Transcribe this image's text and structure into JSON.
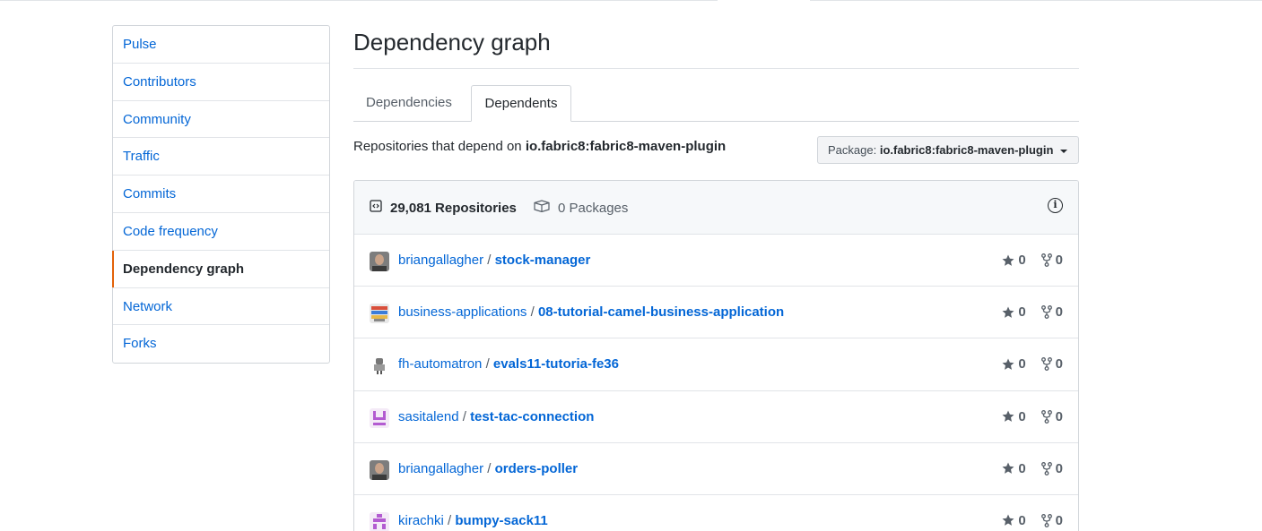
{
  "sidebar": {
    "items": [
      {
        "label": "Pulse"
      },
      {
        "label": "Contributors"
      },
      {
        "label": "Community"
      },
      {
        "label": "Traffic"
      },
      {
        "label": "Commits"
      },
      {
        "label": "Code frequency"
      },
      {
        "label": "Dependency graph",
        "selected": true
      },
      {
        "label": "Network"
      },
      {
        "label": "Forks"
      }
    ]
  },
  "main": {
    "title": "Dependency graph",
    "tabs": [
      {
        "label": "Dependencies"
      },
      {
        "label": "Dependents",
        "selected": true
      }
    ],
    "depends_prefix": "Repositories that depend on",
    "depends_package": "io.fabric8:fabric8-maven-plugin",
    "package_select": {
      "label": "Package:",
      "value": "io.fabric8:fabric8-maven-plugin"
    },
    "summary": {
      "repositories": "29,081 Repositories",
      "packages": "0 Packages"
    },
    "rows": [
      {
        "owner": "briangallagher",
        "repo": "stock-manager",
        "stars": "0",
        "forks": "0"
      },
      {
        "owner": "business-applications",
        "repo": "08-tutorial-camel-business-application",
        "stars": "0",
        "forks": "0"
      },
      {
        "owner": "fh-automatron",
        "repo": "evals11-tutoria-fe36",
        "stars": "0",
        "forks": "0"
      },
      {
        "owner": "sasitalend",
        "repo": "test-tac-connection",
        "stars": "0",
        "forks": "0"
      },
      {
        "owner": "briangallagher",
        "repo": "orders-poller",
        "stars": "0",
        "forks": "0"
      },
      {
        "owner": "kirachki",
        "repo": "bumpy-sack11",
        "stars": "0",
        "forks": "0"
      }
    ]
  },
  "colors": {
    "link": "#0366d6",
    "selected_accent": "#e36209",
    "border": "#d1d5da"
  }
}
